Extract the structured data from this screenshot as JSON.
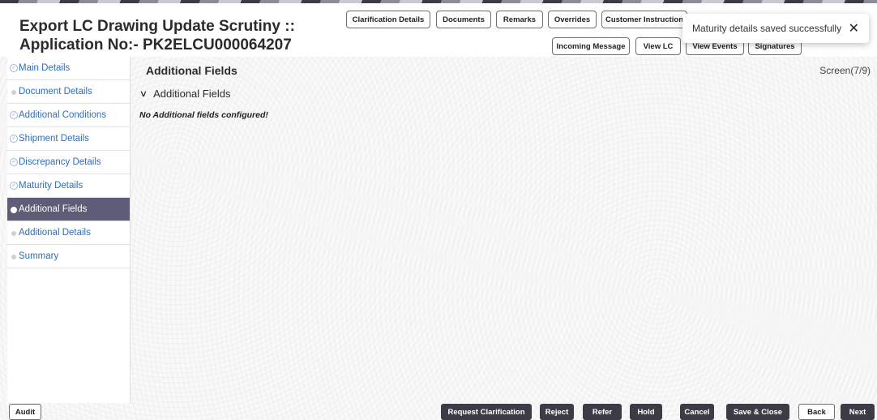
{
  "header": {
    "title": "Export LC Drawing Update Scrutiny :: Application No:- PK2ELCU000064207",
    "buttons_row1": {
      "clarification": "Clarification Details",
      "documents": "Documents",
      "remarks": "Remarks",
      "overrides": "Overrides",
      "customer_instruction": "Customer Instruction"
    },
    "buttons_row2": {
      "incoming_message": "Incoming Message",
      "view_lc": "View LC",
      "view_events": "View Events",
      "signatures": "Signatures"
    }
  },
  "toast": {
    "message": "Maturity details saved successfully",
    "close": "✕"
  },
  "sidebar": {
    "items": [
      {
        "label": "Main Details",
        "state": "done"
      },
      {
        "label": "Document Details",
        "state": "pending"
      },
      {
        "label": "Additional Conditions",
        "state": "done"
      },
      {
        "label": "Shipment Details",
        "state": "done"
      },
      {
        "label": "Discrepancy Details",
        "state": "done"
      },
      {
        "label": "Maturity Details",
        "state": "done"
      },
      {
        "label": "Additional Fields",
        "state": "active"
      },
      {
        "label": "Additional Details",
        "state": "pending"
      },
      {
        "label": "Summary",
        "state": "pending"
      }
    ]
  },
  "main": {
    "title": "Additional Fields",
    "screen_count": "Screen(7/9)",
    "section_header": "Additional Fields",
    "chevron": "∨",
    "empty_message": "No Additional fields configured!"
  },
  "footer": {
    "audit": "Audit",
    "request_clarification": "Request Clarification",
    "reject": "Reject",
    "refer": "Refer",
    "hold": "Hold",
    "cancel": "Cancel",
    "save_close": "Save & Close",
    "back": "Back",
    "next": "Next"
  },
  "colors": {
    "active_nav": "#5e5d77",
    "dark_button": "#3d3b45",
    "link": "#2f6dbb"
  }
}
